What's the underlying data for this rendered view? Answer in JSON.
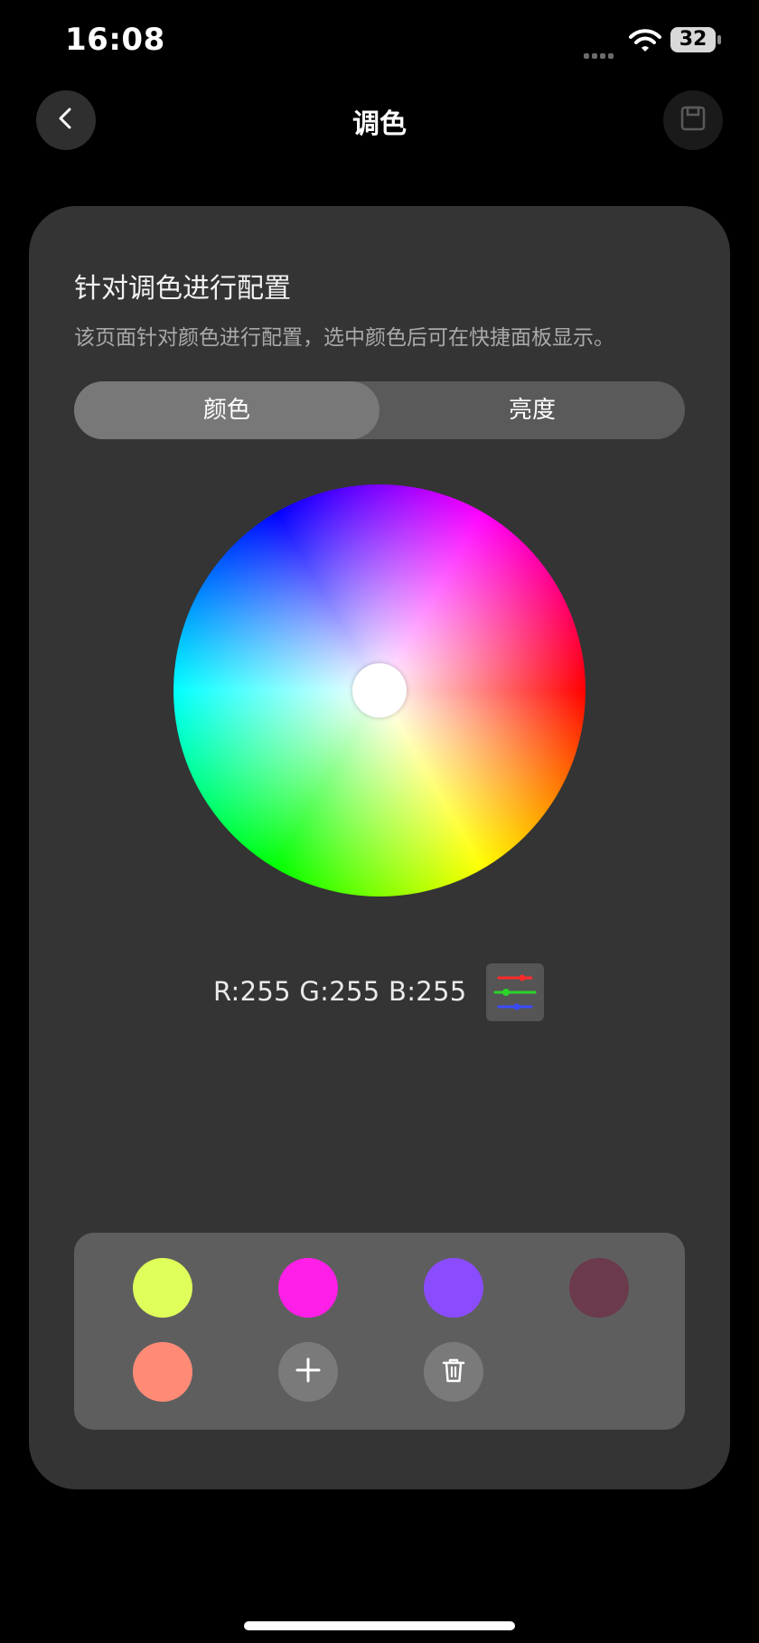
{
  "status_bar": {
    "time": "16:08",
    "battery": "32"
  },
  "nav": {
    "title": "调色"
  },
  "card": {
    "title": "针对调色进行配置",
    "description": "该页面针对颜色进行配置，选中颜色后可在快捷面板显示。",
    "tabs": [
      {
        "label": "颜色",
        "active": true
      },
      {
        "label": "亮度",
        "active": false
      }
    ],
    "rgb_readout": "R:255  G:255  B:255",
    "swatches": [
      "#dfff5b",
      "#ff1fe6",
      "#8b4cff",
      "#6b3a4d",
      "#ff8b77"
    ]
  },
  "icons": {
    "back": "chevron-left-icon",
    "save": "save-icon",
    "rgb_adjust": "rgb-sliders-icon",
    "add": "plus-icon",
    "delete": "trash-icon"
  }
}
